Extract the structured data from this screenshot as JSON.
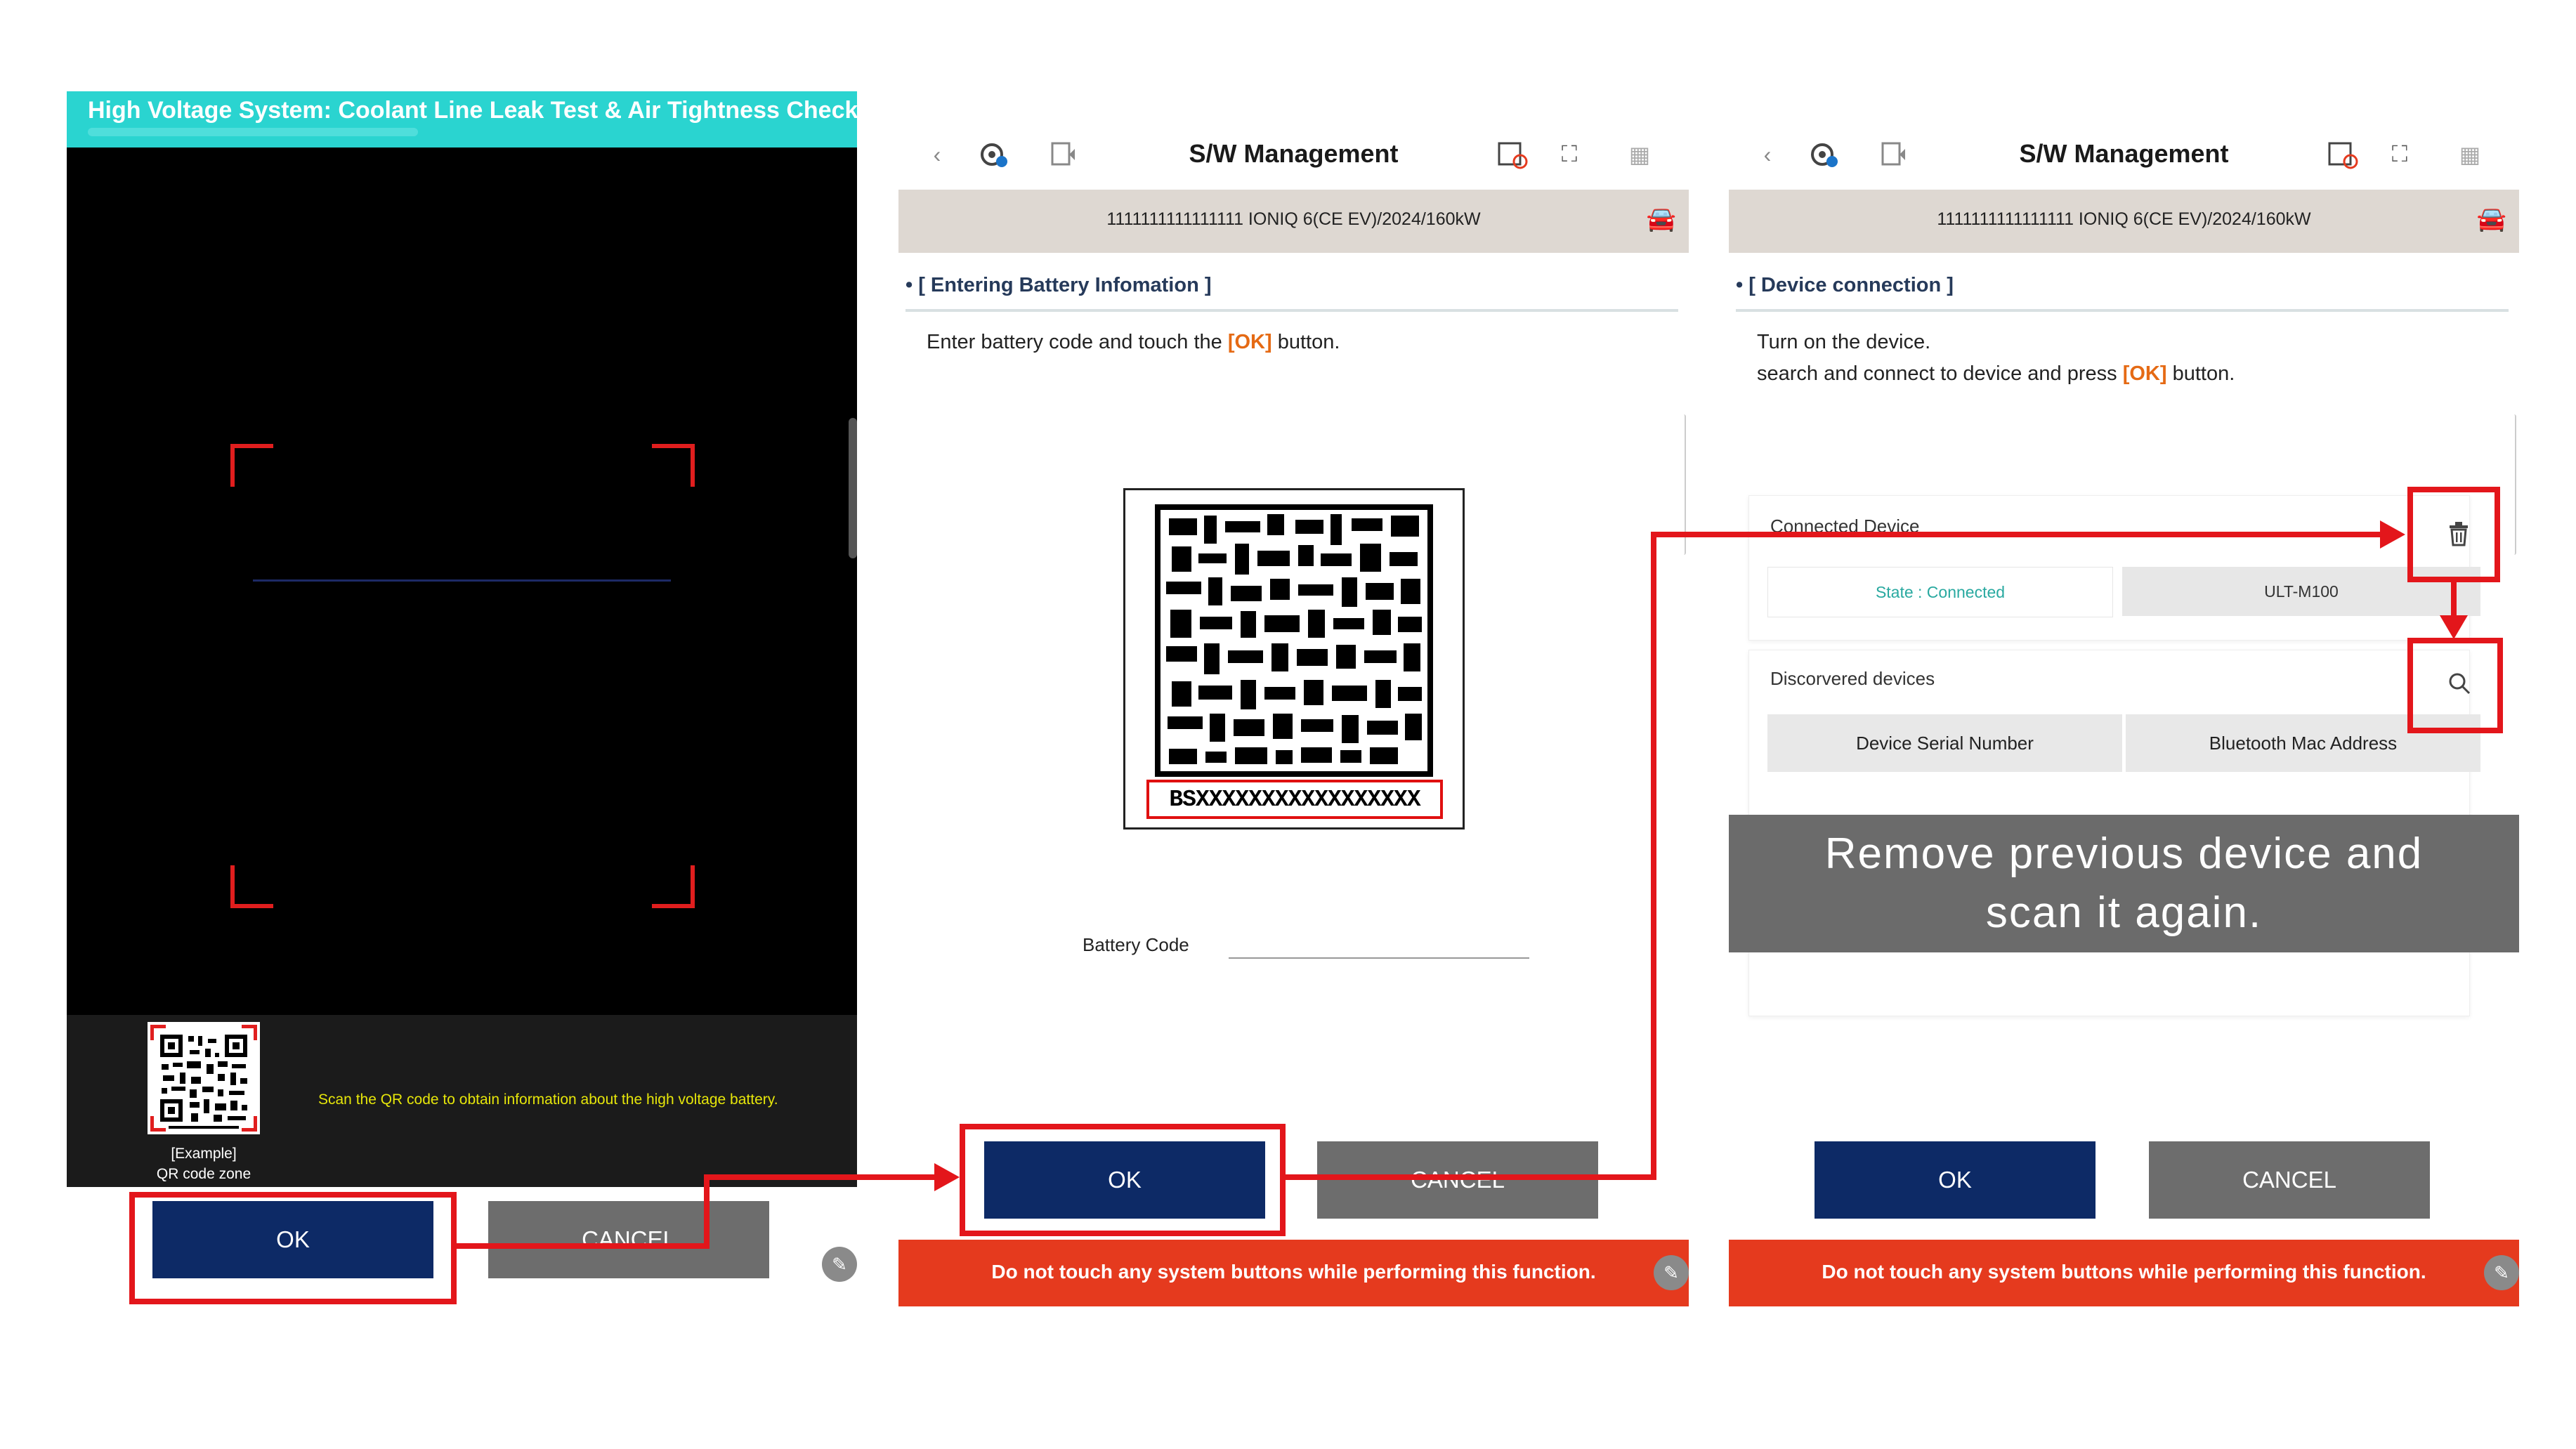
{
  "panel1": {
    "title": "High Voltage System: Coolant Line Leak Test & Air Tightness Check",
    "example_label": "[Example]",
    "qr_zone_label": "QR code zone",
    "scan_message": "Scan the QR code to obtain information about the high voltage battery.",
    "ok_label": "OK",
    "cancel_label": "CANCEL"
  },
  "panel2": {
    "app_title": "S/W Management",
    "vehicle_info": "1111111111111111   IONIQ 6(CE EV)/2024/160kW",
    "section_title": "[ Entering Battery Infomation ]",
    "instruction_pre": "Enter battery code and touch the ",
    "instruction_hl": "[OK]",
    "instruction_post": " button.",
    "battery_code_example": "BSXXXXXXXXXXXXXXXXX",
    "battery_code_label": "Battery Code",
    "battery_code_value": "",
    "ok_label": "OK",
    "cancel_label": "CANCEL",
    "warning": "Do not touch any system buttons while performing this function."
  },
  "panel3": {
    "app_title": "S/W Management",
    "vehicle_info": "1111111111111111   IONIQ 6(CE EV)/2024/160kW",
    "section_title": "[ Device connection ]",
    "instruction_line1": "Turn on the device.",
    "instruction_line2_pre": "search and connect to device and press ",
    "instruction_line2_hl": "[OK]",
    "instruction_line2_post": " button.",
    "connected_device_label": "Connected Device",
    "state_text": "State : Connected",
    "device_model": "ULT-M100",
    "discovered_label": "Discorvered devices",
    "col_serial": "Device Serial Number",
    "col_mac": "Bluetooth Mac Address",
    "ok_label": "OK",
    "cancel_label": "CANCEL",
    "warning": "Do not touch any system buttons while performing this function."
  },
  "annotation": {
    "banner_line1": "Remove previous device and",
    "banner_line2": "scan it again."
  },
  "colors": {
    "accent_cyan": "#2ad4d0",
    "ok_navy": "#0d2a66",
    "cancel_gray": "#6d6d6d",
    "warning_red": "#e53a1e",
    "highlight_orange": "#e56a14",
    "annotation_red": "#e3161b"
  },
  "icons": [
    "back-chevron-icon",
    "settings-sync-icon",
    "export-icon",
    "calendar-status-icon",
    "expand-icon",
    "grid-menu-icon",
    "car-status-icon",
    "trash-icon",
    "search-icon",
    "edit-pencil-icon"
  ]
}
